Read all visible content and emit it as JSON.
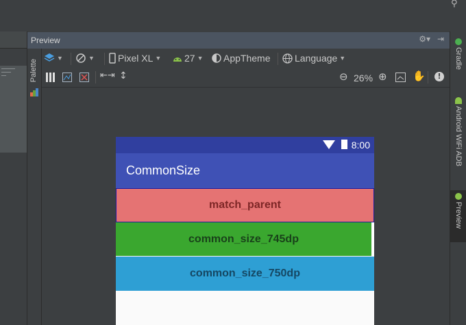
{
  "panel": {
    "title": "Preview"
  },
  "palette": {
    "label": "Palette"
  },
  "toolbar": {
    "device": "Pixel XL",
    "api": "27",
    "theme": "AppTheme",
    "language": "Language",
    "zoom": "26%"
  },
  "device_screen": {
    "time": "8:00",
    "app_title": "CommonSize",
    "rows": [
      "match_parent",
      "common_size_745dp",
      "common_size_750dp"
    ]
  },
  "right_tabs": [
    "Gradle",
    "Android WiFi ADB",
    "Preview"
  ],
  "colors": {
    "status_bar": "#303f9f",
    "app_bar": "#3f51b5",
    "row_match": "#e57373",
    "row_745": "#3aa72f",
    "row_750": "#2e9fd4"
  }
}
